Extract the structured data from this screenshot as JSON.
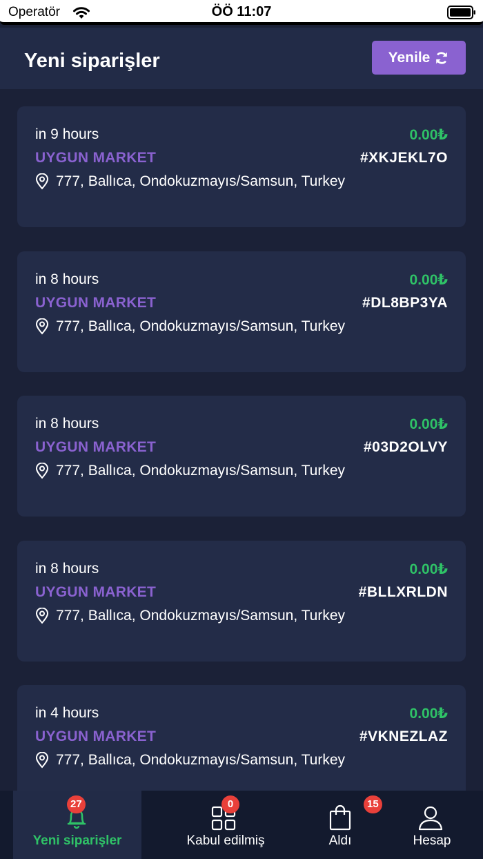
{
  "status_bar": {
    "carrier": "Operatör",
    "time": "ÖÖ 11:07"
  },
  "header": {
    "title": "Yeni siparişler",
    "refresh_label": "Yenile"
  },
  "orders": [
    {
      "time": "in 9 hours",
      "amount": "0.00₺",
      "store": "UYGUN MARKET",
      "code": "#XKJEKL7O",
      "address": "777, Ballıca, Ondokuzmayıs/Samsun, Turkey"
    },
    {
      "time": "in 8 hours",
      "amount": "0.00₺",
      "store": "UYGUN MARKET",
      "code": "#DL8BP3YA",
      "address": "777, Ballıca, Ondokuzmayıs/Samsun, Turkey"
    },
    {
      "time": "in 8 hours",
      "amount": "0.00₺",
      "store": "UYGUN MARKET",
      "code": "#03D2OLVY",
      "address": "777, Ballıca, Ondokuzmayıs/Samsun, Turkey"
    },
    {
      "time": "in 8 hours",
      "amount": "0.00₺",
      "store": "UYGUN MARKET",
      "code": "#BLLXRLDN",
      "address": "777, Ballıca, Ondokuzmayıs/Samsun, Turkey"
    },
    {
      "time": "in 4 hours",
      "amount": "0.00₺",
      "store": "UYGUN MARKET",
      "code": "#VKNEZLAZ",
      "address": "777, Ballıca, Ondokuzmayıs/Samsun, Turkey"
    }
  ],
  "tabs": [
    {
      "label": "Yeni siparişler",
      "badge": "27",
      "icon": "bell-icon",
      "active": true
    },
    {
      "label": "Kabul edilmiş",
      "badge": "0",
      "icon": "grid-icon",
      "active": false
    },
    {
      "label": "Aldı",
      "badge": "15",
      "icon": "shopping-bag-icon",
      "active": false
    },
    {
      "label": "Hesap",
      "badge": "",
      "icon": "user-icon",
      "active": false
    }
  ],
  "colors": {
    "background": "#1b2137",
    "card": "#232c48",
    "accent_purple": "#8a62d0",
    "amount_green": "#2fc267",
    "badge_red": "#e9403a"
  }
}
